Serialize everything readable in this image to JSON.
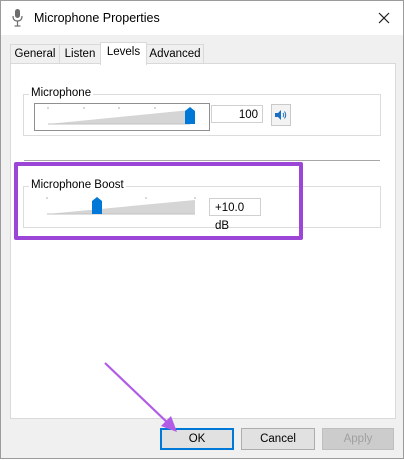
{
  "window": {
    "title": "Microphone Properties"
  },
  "tabs": [
    {
      "label": "General",
      "active": false
    },
    {
      "label": "Listen",
      "active": false
    },
    {
      "label": "Levels",
      "active": true
    },
    {
      "label": "Advanced",
      "active": false
    }
  ],
  "levels": {
    "microphone": {
      "label": "Microphone",
      "value": "100",
      "level_fraction": 1.0
    },
    "boost": {
      "label": "Microphone Boost",
      "value": "+10.0 dB",
      "level_fraction": 0.33
    }
  },
  "buttons": {
    "ok": "OK",
    "cancel": "Cancel",
    "apply": "Apply"
  },
  "colors": {
    "highlight": "#9b46d6",
    "arrow": "#b05ce6",
    "accent": "#0078d7"
  },
  "icons": [
    "microphone-icon",
    "close-icon",
    "speaker-icon",
    "slider-thumb-icon"
  ]
}
